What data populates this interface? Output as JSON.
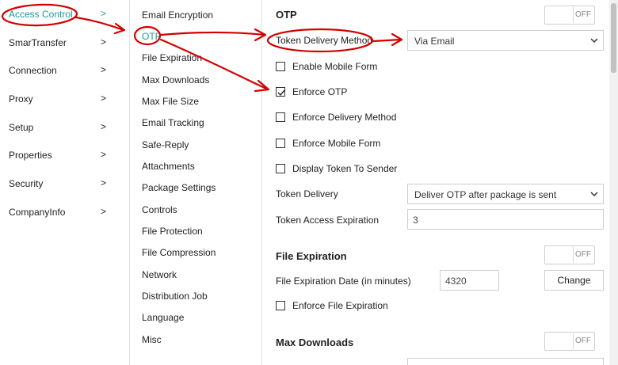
{
  "nav": {
    "items": [
      {
        "label": "Access Control",
        "chevron": ">"
      },
      {
        "label": "SmarTransfer",
        "chevron": ">"
      },
      {
        "label": "Connection",
        "chevron": ">"
      },
      {
        "label": "Proxy",
        "chevron": ">"
      },
      {
        "label": "Setup",
        "chevron": ">"
      },
      {
        "label": "Properties",
        "chevron": ">"
      },
      {
        "label": "Security",
        "chevron": ">"
      },
      {
        "label": "CompanyInfo",
        "chevron": ">"
      }
    ],
    "active_index": 0
  },
  "subnav": {
    "items": [
      {
        "label": "Email Encryption"
      },
      {
        "label": "OTP"
      },
      {
        "label": "File Expiration"
      },
      {
        "label": "Max Downloads"
      },
      {
        "label": "Max File Size"
      },
      {
        "label": "Email Tracking"
      },
      {
        "label": "Safe-Reply"
      },
      {
        "label": "Attachments"
      },
      {
        "label": "Package Settings"
      },
      {
        "label": "Controls"
      },
      {
        "label": "File Protection"
      },
      {
        "label": "File Compression"
      },
      {
        "label": "Network"
      },
      {
        "label": "Distribution Job"
      },
      {
        "label": "Language"
      },
      {
        "label": "Misc"
      }
    ],
    "active_index": 1
  },
  "otp": {
    "title": "OTP",
    "toggle_state": "OFF",
    "token_delivery_method": {
      "label": "Token Delivery Method",
      "value": "Via Email"
    },
    "checkboxes": [
      {
        "label": "Enable Mobile Form",
        "checked": false
      },
      {
        "label": "Enforce OTP",
        "checked": true
      },
      {
        "label": "Enforce Delivery Method",
        "checked": false
      },
      {
        "label": "Enforce Mobile Form",
        "checked": false
      },
      {
        "label": "Display Token To Sender",
        "checked": false
      }
    ],
    "token_delivery": {
      "label": "Token Delivery",
      "value": "Deliver OTP after package is sent"
    },
    "token_access_expiration": {
      "label": "Token Access Expiration",
      "value": "3"
    }
  },
  "file_expiration": {
    "title": "File Expiration",
    "toggle_state": "OFF",
    "date_label": "File Expiration Date (in minutes)",
    "date_value": "4320",
    "change_label": "Change",
    "enforce_label": "Enforce File Expiration"
  },
  "max_downloads": {
    "title": "Max Downloads",
    "toggle_state": "OFF"
  },
  "colors": {
    "accent": "#1a9a9a",
    "annotation": "#d40000"
  }
}
